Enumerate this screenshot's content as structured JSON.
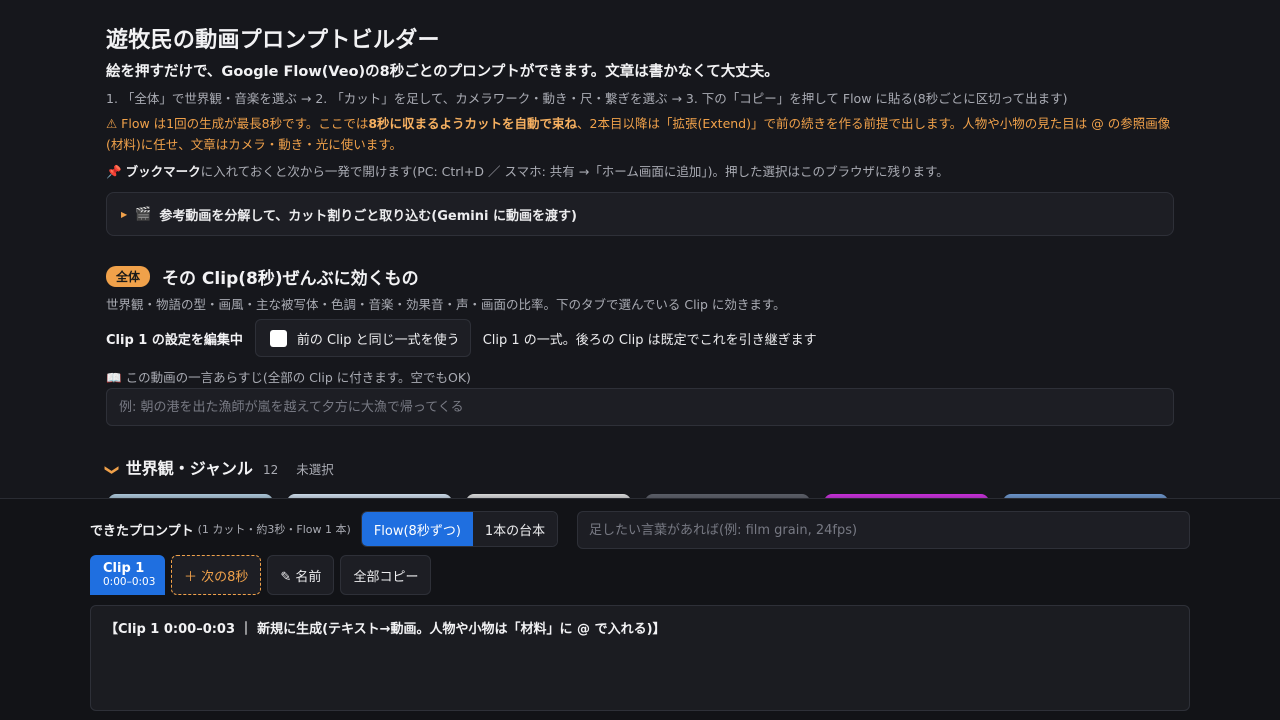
{
  "header": {
    "title": "遊牧民の動画プロンプトビルダー",
    "subtitle": "絵を押すだけで、Google Flow(Veo)の8秒ごとのプロンプトができます。文章は書かなくて大丈夫。",
    "steps": "1. 「全体」で世界観・音楽を選ぶ → 2. 「カット」を足して、カメラワーク・動き・尺・繋ぎを選ぶ → 3. 下の「コピー」を押して Flow に貼る(8秒ごとに区切って出ます)",
    "warning_a": "⚠ Flow は1回の生成が最長8秒です。ここでは",
    "warning_b": "8秒に収まるようカットを自動で束ね",
    "warning_c": "、2本目以降は「拡張(Extend)」で前の続きを作る前提で出します。人物や小物の見た目は @ の参照画像(材料)に任せ、文章はカメラ・動き・光に使います。",
    "bookmark_icon": "📌",
    "bookmark_bold": "ブックマーク",
    "bookmark_rest": "に入れておくと次から一発で開けます(PC: Ctrl+D ／ スマホ: 共有 →「ホーム画面に追加」)。押した選択はこのブラウザに残ります。"
  },
  "reference": {
    "icon": "🎬",
    "label": "参考動画を分解して、カット割りごと取り込む(Gemini に動画を渡す)"
  },
  "global_section": {
    "badge": "全体",
    "title": "その Clip(8秒)ぜんぶに効くもの",
    "desc": "世界観・物語の型・画風・主な被写体・色調・音楽・効果音・声・画面の比率。下のタブで選んでいる Clip に効きます。",
    "editing": "Clip 1 の設定を編集中",
    "same_label": "前の Clip と同じ一式を使う",
    "clip_note": "Clip 1 の一式。後ろの Clip は既定でこれを引き継ぎます",
    "summary_icon": "📖",
    "summary_label": "この動画の一言あらすじ(全部の Clip に付きます。空でもOK)",
    "summary_placeholder": "例: 朝の港を出た漁師が嵐を越えて夕方に大漁で帰ってくる"
  },
  "genre": {
    "chevron": "❯",
    "title": "世界観・ジャンル",
    "count": "12",
    "status": "未選択",
    "thumb_colors": [
      "#a9c4d6",
      "#c9d8e6",
      "#d6d6d6",
      "#5a5d66",
      "#c62fd8",
      "#6a93c8"
    ]
  },
  "output": {
    "title": "できたプロンプト",
    "meta": "(1 カット・約3秒・Flow 1 本)",
    "mode_flow": "Flow(8秒ずつ)",
    "mode_script": "1本の台本",
    "extra_placeholder": "足したい言葉があれば(例: film grain, 24fps)",
    "clip_tab_name": "Clip 1",
    "clip_tab_time": "0:00–0:03",
    "next_button": "＋ 次の8秒",
    "name_button": "✎ 名前",
    "copy_all_button": "全部コピー",
    "prompt_text": "【Clip 1  0:00–0:03 ｜ 新規に生成(テキスト→動画。人物や小物は「材料」に @ で入れる)】"
  },
  "colors": {
    "accent": "#f0a14a",
    "primary": "#1f6fe0",
    "background": "#16171c"
  }
}
